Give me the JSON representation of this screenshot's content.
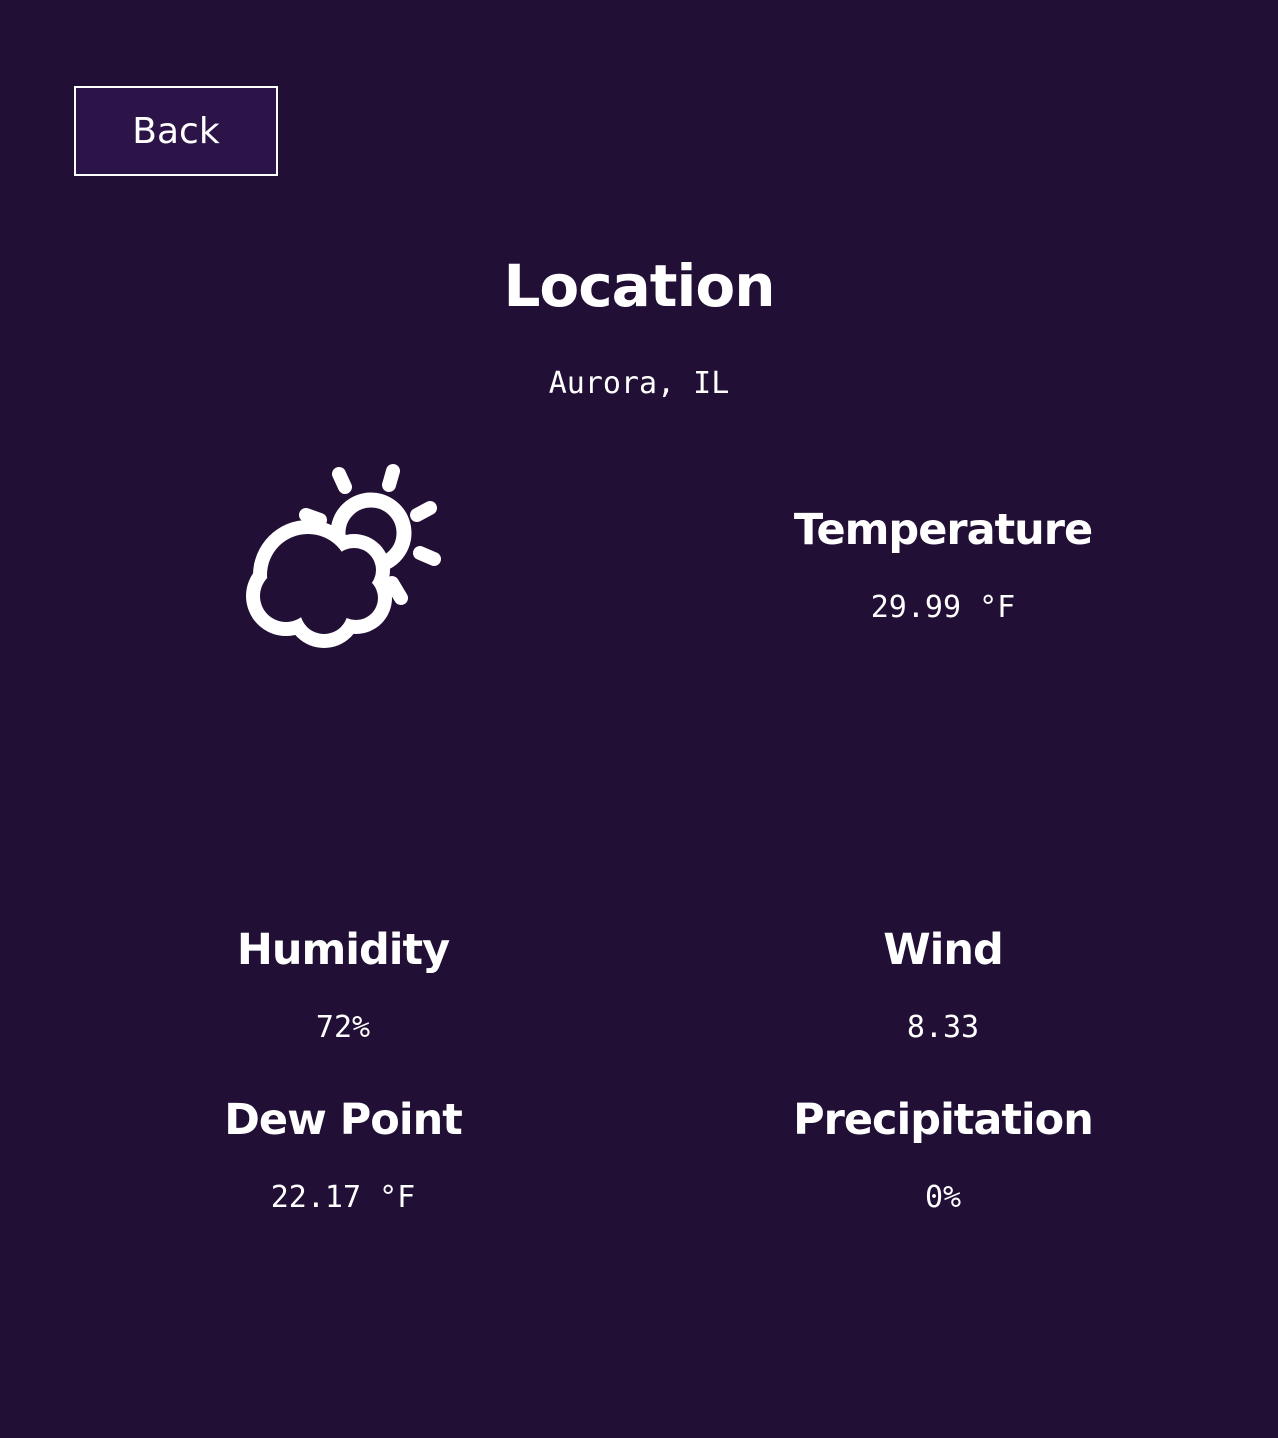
{
  "back_button": {
    "label": "Back"
  },
  "header": {
    "title": "Location",
    "location": "Aurora, IL"
  },
  "weather_icon": "partly-cloudy-icon",
  "stats": {
    "temperature": {
      "label": "Temperature",
      "value": "29.99 °F"
    },
    "humidity": {
      "label": "Humidity",
      "value": "72%"
    },
    "wind": {
      "label": "Wind",
      "value": "8.33"
    },
    "dew_point": {
      "label": "Dew Point",
      "value": "22.17 °F"
    },
    "precipitation": {
      "label": "Precipitation",
      "value": "0%"
    }
  },
  "colors": {
    "background": "#210f35",
    "button_background": "#2c1448",
    "foreground": "#ffffff"
  }
}
